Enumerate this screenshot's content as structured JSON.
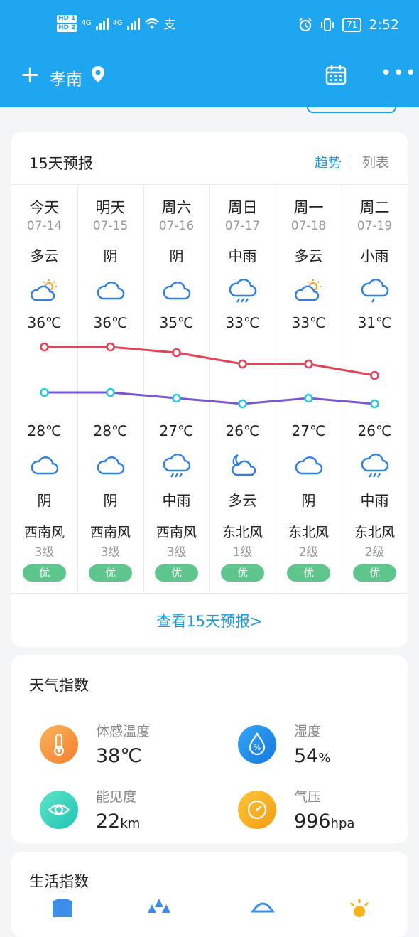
{
  "status_bar": {
    "hd1": "HD 1",
    "hd2": "HD 2",
    "net1": "4G",
    "net2": "4G",
    "battery": "71",
    "time": "2:52"
  },
  "header": {
    "city": "孝南"
  },
  "forecast": {
    "title": "15天预报",
    "tab_trend": "趋势",
    "tab_list": "列表",
    "more": "查看15天预报>",
    "days": [
      {
        "day": "今天",
        "date": "07-14",
        "day_cond": "多云",
        "day_icon": "partly-cloudy-sun-icon",
        "high": "36℃",
        "high_v": 36,
        "low": "28℃",
        "low_v": 28,
        "night_icon": "cloudy-icon",
        "night_cond": "阴",
        "wind": "西南风",
        "level": "3级",
        "aqi": "优"
      },
      {
        "day": "明天",
        "date": "07-15",
        "day_cond": "阴",
        "day_icon": "cloudy-icon",
        "high": "36℃",
        "high_v": 36,
        "low": "28℃",
        "low_v": 28,
        "night_icon": "cloudy-icon",
        "night_cond": "阴",
        "wind": "西南风",
        "level": "3级",
        "aqi": "优"
      },
      {
        "day": "周六",
        "date": "07-16",
        "day_cond": "阴",
        "day_icon": "cloudy-icon",
        "high": "35℃",
        "high_v": 35,
        "low": "27℃",
        "low_v": 27,
        "night_icon": "rain-icon",
        "night_cond": "中雨",
        "wind": "西南风",
        "level": "3级",
        "aqi": "优"
      },
      {
        "day": "周日",
        "date": "07-17",
        "day_cond": "中雨",
        "day_icon": "rain-icon",
        "high": "33℃",
        "high_v": 33,
        "low": "26℃",
        "low_v": 26,
        "night_icon": "partly-cloudy-moon-icon",
        "night_cond": "多云",
        "wind": "东北风",
        "level": "1级",
        "aqi": "优"
      },
      {
        "day": "周一",
        "date": "07-18",
        "day_cond": "多云",
        "day_icon": "partly-cloudy-sun-icon",
        "high": "33℃",
        "high_v": 33,
        "low": "27℃",
        "low_v": 27,
        "night_icon": "cloudy-icon",
        "night_cond": "阴",
        "wind": "东北风",
        "level": "2级",
        "aqi": "优"
      },
      {
        "day": "周二",
        "date": "07-19",
        "day_cond": "小雨",
        "day_icon": "light-rain-icon",
        "high": "31℃",
        "high_v": 31,
        "low": "26℃",
        "low_v": 26,
        "night_icon": "rain-icon",
        "night_cond": "中雨",
        "wind": "东北风",
        "level": "2级",
        "aqi": "优"
      }
    ]
  },
  "weather_index": {
    "title": "天气指数",
    "items": [
      {
        "label": "体感温度",
        "value": "38℃",
        "unit": "",
        "icon": "thermometer-icon",
        "color": "#f59a3c"
      },
      {
        "label": "湿度",
        "value": "54",
        "unit": "%",
        "icon": "humidity-drop-icon",
        "color": "#1d8fe8"
      },
      {
        "label": "能见度",
        "value": "22",
        "unit": "km",
        "icon": "visibility-eye-icon",
        "color": "#2ed3b8"
      },
      {
        "label": "气压",
        "value": "996",
        "unit": "hpa",
        "icon": "pressure-gauge-icon",
        "color": "#f7b21d"
      }
    ]
  },
  "life_index": {
    "title": "生活指数"
  },
  "colors": {
    "header": "#1ea6f0",
    "high_line": "#e24458",
    "low_line": "#7a57d1",
    "low_dot": "#2cc7e0",
    "aqi_good": "#5ec68c",
    "accent": "#1e9be0"
  }
}
